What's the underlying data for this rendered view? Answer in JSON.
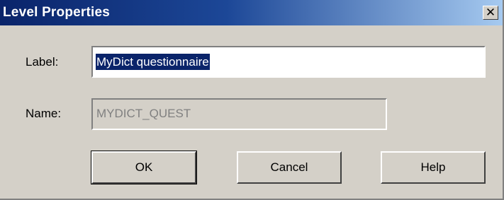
{
  "window": {
    "title": "Level Properties",
    "close_glyph": "✕"
  },
  "form": {
    "label_caption": "Label:",
    "label_value": "MyDict questionnaire",
    "name_caption": "Name:",
    "name_value": "MYDICT_QUEST"
  },
  "buttons": {
    "ok": "OK",
    "cancel": "Cancel",
    "help": "Help"
  },
  "colors": {
    "title_bar_start": "#0a246a",
    "title_bar_end": "#a6caf0",
    "dialog_face": "#d4d0c8",
    "selection": "#0a246a"
  }
}
